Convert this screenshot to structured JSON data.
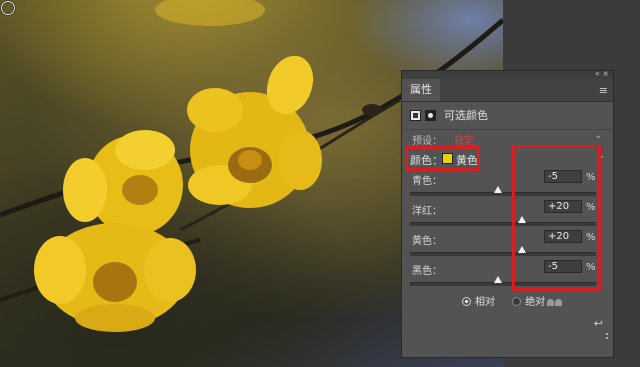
{
  "panel": {
    "tab_label": "属性",
    "window_controls": "«  ×",
    "menu_icon": "menu-icon",
    "adjustment_title": "可选颜色",
    "preset_label": "预设：",
    "preset_value": "自定",
    "colors_label": "颜色：",
    "colors_value": "黄色",
    "colors_swatch": "#f0d000",
    "sliders": [
      {
        "label": "青色：",
        "value": "-5",
        "percent": "%",
        "level": -5
      },
      {
        "label": "洋红：",
        "value": "+20",
        "percent": "%",
        "level": 20
      },
      {
        "label": "黄色：",
        "value": "+20",
        "percent": "%",
        "level": 20
      },
      {
        "label": "黑色：",
        "value": "-5",
        "percent": "%",
        "level": -5
      }
    ],
    "method": {
      "relative_label": "相对",
      "absolute_label": "绝对",
      "selected": "relative"
    }
  },
  "highlight_color": "#d81e1e"
}
